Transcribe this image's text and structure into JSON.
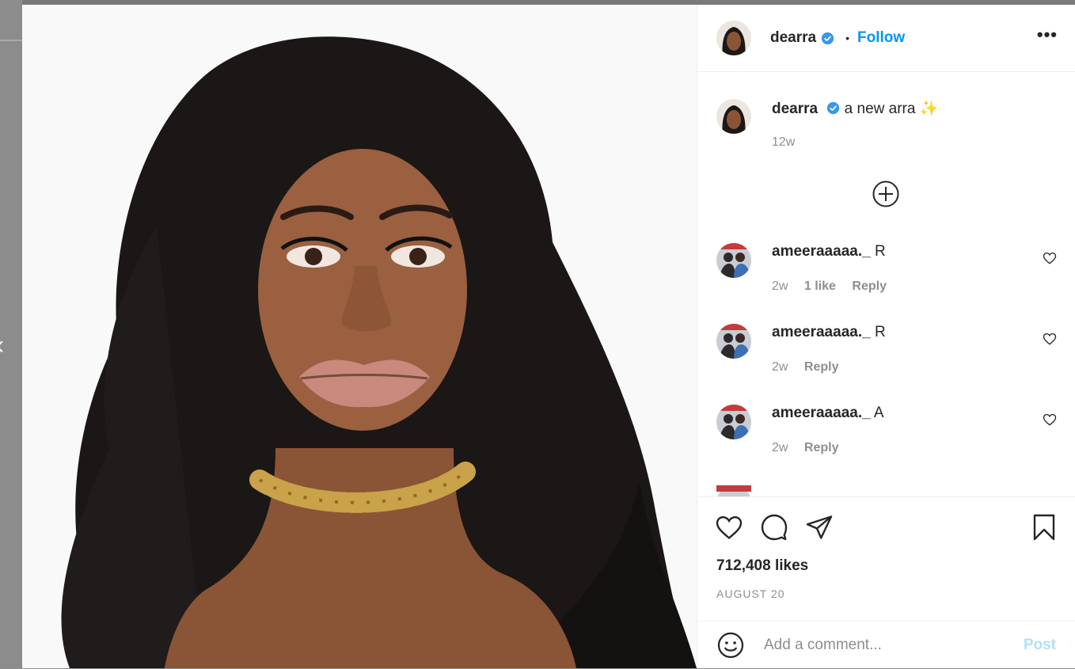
{
  "post": {
    "author": "dearra",
    "follow_label": "Follow",
    "more_label": "•••",
    "caption_text": "a new arra ✨",
    "caption_age": "12w",
    "likes": "712,408 likes",
    "date": "AUGUST 20"
  },
  "comments": [
    {
      "user": "ameeraaaaa._",
      "text": "R",
      "age": "2w",
      "likes_label": "1 like",
      "reply_label": "Reply"
    },
    {
      "user": "ameeraaaaa._",
      "text": "R",
      "age": "2w",
      "likes_label": "",
      "reply_label": "Reply"
    },
    {
      "user": "ameeraaaaa._",
      "text": "A",
      "age": "2w",
      "likes_label": "",
      "reply_label": "Reply"
    }
  ],
  "composer": {
    "placeholder": "Add a comment...",
    "post_label": "Post"
  },
  "icons": {
    "verified": "verified-badge-icon",
    "load_more": "plus-circle-icon",
    "like": "heart-icon",
    "comment": "comment-icon",
    "share": "paper-plane-icon",
    "save": "bookmark-icon",
    "emoji": "emoji-icon",
    "prev": "chevron-left-icon"
  },
  "colors": {
    "accent": "#0095f6",
    "post_disabled": "#b2dffc",
    "muted": "#8e8e8e",
    "text": "#262626"
  }
}
